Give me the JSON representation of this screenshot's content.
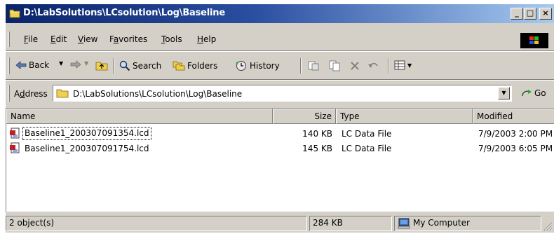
{
  "window": {
    "title": "D:\\LabSolutions\\LCsolution\\Log\\Baseline",
    "controls": {
      "minimize": "_",
      "maximize": "□",
      "close": "×"
    }
  },
  "menubar": {
    "items": [
      {
        "label": "File",
        "accel": "F",
        "rest": "ile"
      },
      {
        "label": "Edit",
        "accel": "E",
        "rest": "dit"
      },
      {
        "label": "View",
        "accel": "V",
        "rest": "iew"
      },
      {
        "label": "Favorites",
        "pre": "F",
        "accel": "a",
        "rest": "vorites"
      },
      {
        "label": "Tools",
        "accel": "T",
        "rest": "ools"
      },
      {
        "label": "Help",
        "accel": "H",
        "rest": "elp"
      }
    ]
  },
  "toolbar": {
    "back_label": "Back",
    "search_label": "Search",
    "folders_label": "Folders",
    "history_label": "History"
  },
  "addressbar": {
    "label": "Address",
    "label_accel": "d",
    "value": "D:\\LabSolutions\\LCsolution\\Log\\Baseline",
    "go_label": "Go"
  },
  "filelist": {
    "columns": [
      "Name",
      "Size",
      "Type",
      "Modified"
    ],
    "rows": [
      {
        "name": "Baseline1_200307091354.lcd",
        "size": "140 KB",
        "type": "LC Data File",
        "modified": "7/9/2003 2:00 PM",
        "focused": true
      },
      {
        "name": "Baseline1_200307091754.lcd",
        "size": "145 KB",
        "type": "LC Data File",
        "modified": "7/9/2003 6:05 PM",
        "focused": false
      }
    ]
  },
  "statusbar": {
    "object_count": "2 object(s)",
    "total_size": "284 KB",
    "zone": "My Computer"
  },
  "colors": {
    "title_start": "#0a246a",
    "title_end": "#a6caf0",
    "face": "#d4d0c8"
  }
}
